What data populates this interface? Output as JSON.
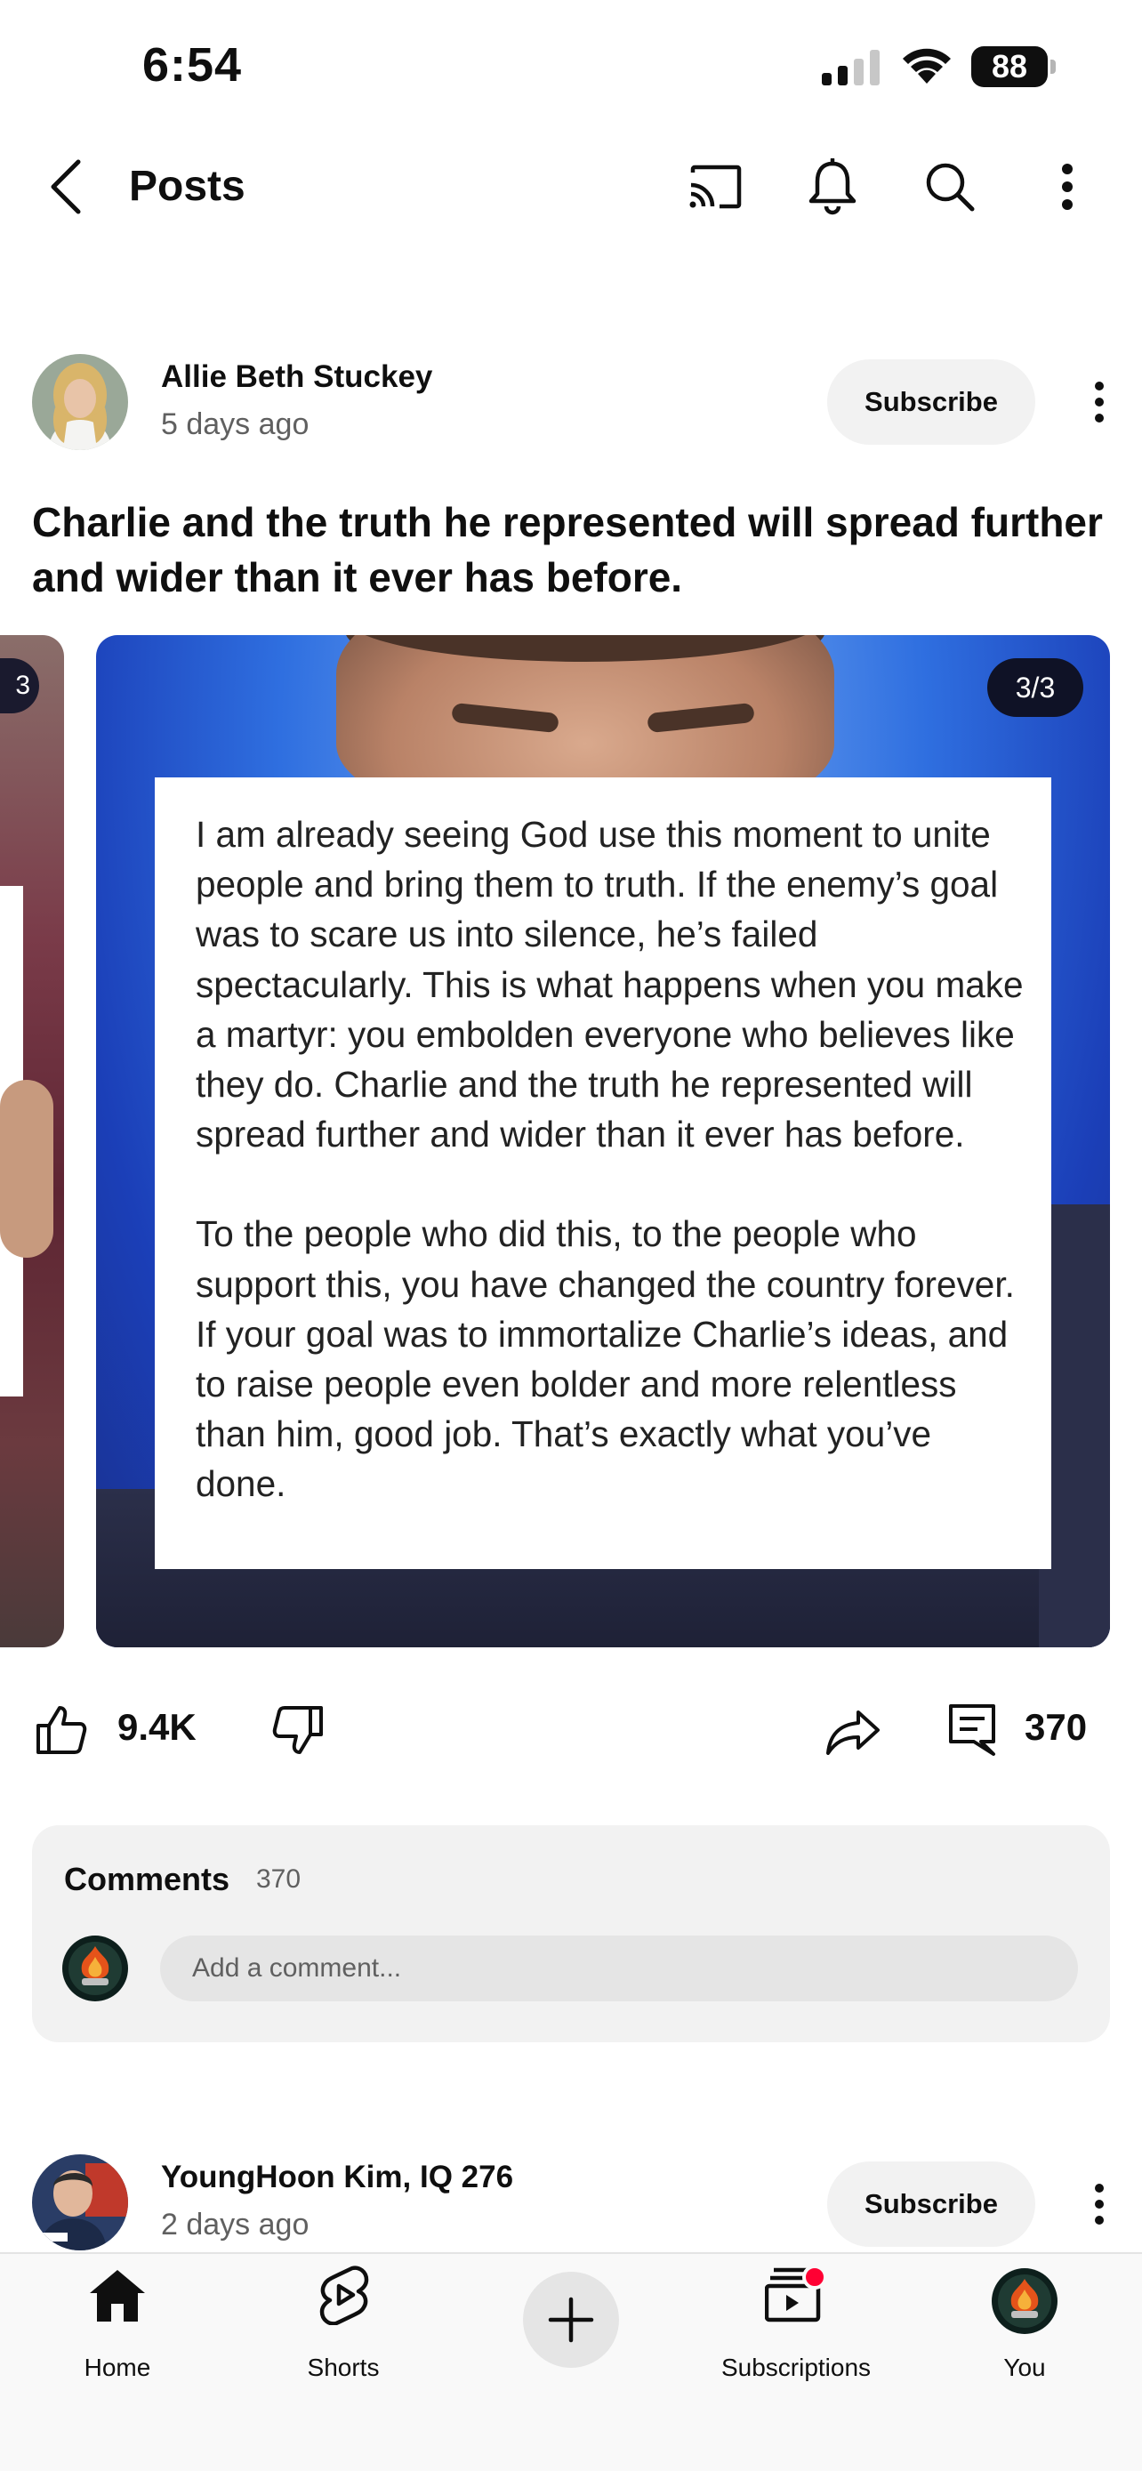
{
  "status_bar": {
    "time": "6:54",
    "battery": "88"
  },
  "header": {
    "title": "Posts"
  },
  "post": {
    "channel": "Allie Beth Stuckey",
    "date": "5 days ago",
    "subscribe_label": "Subscribe",
    "title": "Charlie and the truth he represented will spread further and wider than it ever has before.",
    "image_page": "3/3",
    "prev_image_page": "3",
    "image_text_1": "I am already seeing God use this moment to unite people and bring them to truth. If the enemy’s goal was to scare us into silence, he’s failed spectacularly. This is what happens when you make a martyr: you embolden everyone who believes like they do. Charlie and the truth he represented will spread further and wider than it ever has before.",
    "image_text_2": "To the people who did this, to the people who support this,  you have changed the country forever. If your goal was to immortalize Charlie’s ideas, and to raise people even bolder and more relentless than him, good job. That’s exactly what you’ve done.",
    "likes": "9.4K",
    "comments_count": "370"
  },
  "comments": {
    "title": "Comments",
    "count": "370",
    "placeholder": "Add a comment..."
  },
  "post2": {
    "channel": "YoungHoon Kim, IQ 276",
    "date": "2 days ago",
    "subscribe_label": "Subscribe"
  },
  "bottom_nav": {
    "items": [
      {
        "label": "Home",
        "icon": "home-icon"
      },
      {
        "label": "Shorts",
        "icon": "shorts-icon"
      },
      {
        "label": "",
        "icon": "create-icon"
      },
      {
        "label": "Subscriptions",
        "icon": "subscriptions-icon"
      },
      {
        "label": "You",
        "icon": "avatar"
      }
    ]
  },
  "colors": {
    "notification_dot": "#ff0033",
    "subscribe_bg": "#f2f2f2",
    "text_primary": "#0f0f0f",
    "text_secondary": "#606060"
  }
}
